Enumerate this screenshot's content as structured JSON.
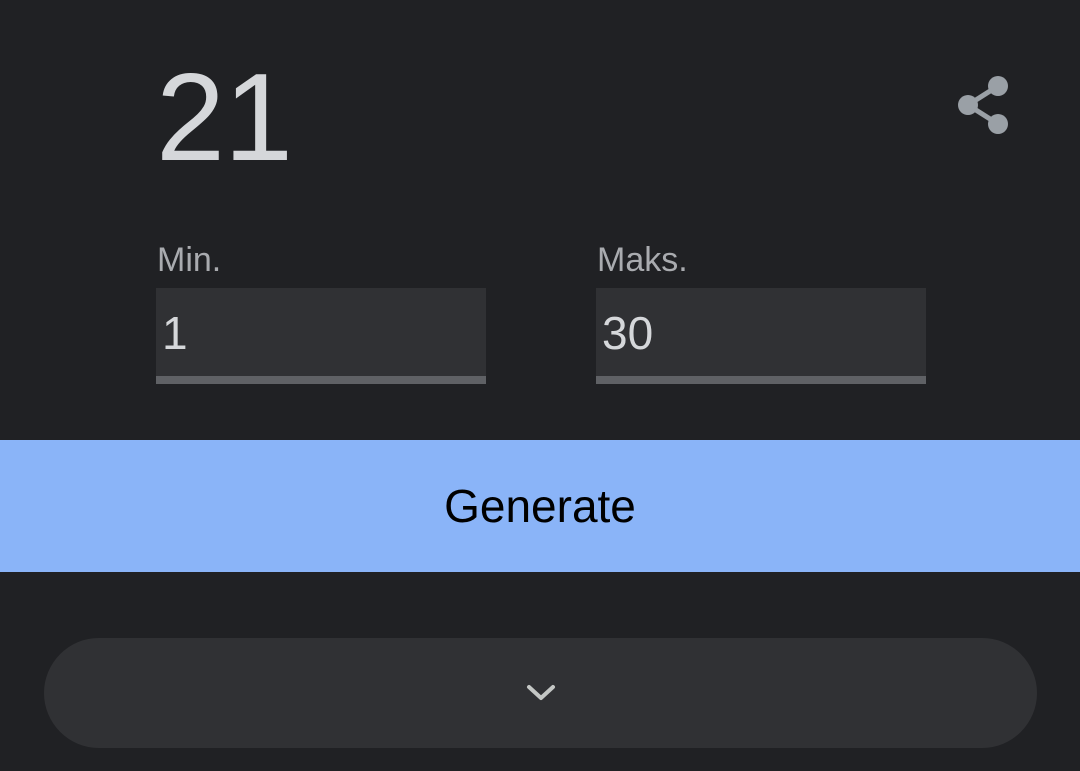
{
  "result": {
    "value": "21"
  },
  "icons": {
    "share": "share-icon",
    "expand": "chevron-down-icon"
  },
  "min": {
    "label": "Min.",
    "value": "1"
  },
  "max": {
    "label": "Maks.",
    "value": "30"
  },
  "generate": {
    "label": "Generate"
  },
  "colors": {
    "background": "#202124",
    "field": "#303134",
    "underline": "#5f6165",
    "accent": "#8ab4f8",
    "text": "#d5d7da",
    "icon": "#9aa0a6"
  }
}
